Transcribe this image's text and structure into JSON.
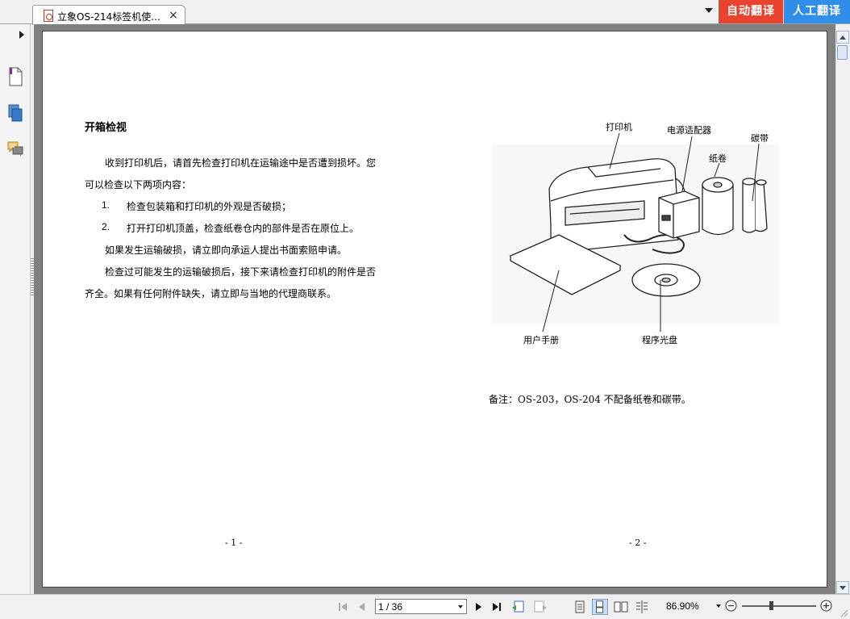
{
  "tabs": [
    {
      "title": "立象OS-214标签机使...",
      "close_symbol": "×"
    }
  ],
  "translate_buttons": {
    "auto": "自动翻译",
    "human": "人工翻译",
    "auto_color": "#e8432f",
    "human_color": "#2f8fe8"
  },
  "sidebar": {
    "icons": [
      "page-thumbnails-icon",
      "layers-icon",
      "comments-icon"
    ]
  },
  "page1": {
    "title": "开箱检视",
    "para1_line1": "收到打印机后，请首先检查打印机在运输途中是否遭到损坏。您",
    "para1_line2": "可以检查以下两项内容：",
    "list": [
      {
        "num": "1.",
        "text": "检查包装箱和打印机的外观是否破损；"
      },
      {
        "num": "2.",
        "text": "打开打印机顶盖，检查纸卷仓内的部件是否在原位上。"
      }
    ],
    "para2": "如果发生运输破损，请立即向承运人提出书面索赔申请。",
    "para3_line1": "检查过可能发生的运输破损后，接下来请检查打印机的附件是否",
    "para3_line2": "齐全。如果有任何附件缺失，请立即与当地的代理商联系。",
    "page_number": "- 1 -"
  },
  "page2": {
    "callouts": {
      "printer": "打印机",
      "adapter": "电源适配器",
      "paper_roll": "纸卷",
      "ribbon": "碳带",
      "manual": "用户手册",
      "cd": "程序光盘"
    },
    "note": "备注：OS-203，OS-204 不配备纸卷和碳带。",
    "page_number": "- 2 -"
  },
  "statusbar": {
    "page_field": "1 / 36",
    "zoom": "86.90%",
    "zoom_fraction": 0.4,
    "active_view": "continuous"
  }
}
